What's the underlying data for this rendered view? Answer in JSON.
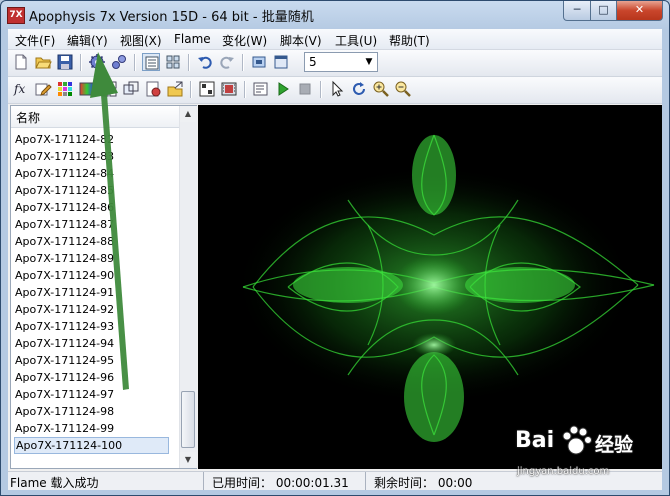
{
  "window": {
    "title": "Apophysis 7x Version 15D  - 64 bit - 批量随机",
    "app_icon": "7X",
    "controls": {
      "minimize": "─",
      "maximize": "□",
      "close": "✕"
    }
  },
  "menu": [
    {
      "label": "文件(F)"
    },
    {
      "label": "编辑(Y)"
    },
    {
      "label": "视图(X)"
    },
    {
      "label": "Flame"
    },
    {
      "label": "变化(W)"
    },
    {
      "label": "脚本(V)"
    },
    {
      "label": "工具(U)"
    },
    {
      "label": "帮助(T)"
    }
  ],
  "toolbar": {
    "zoom_select_value": "5",
    "zoom_select_arrow": "▼"
  },
  "list": {
    "header": "名称",
    "items": [
      "Apo7X-171124-82",
      "Apo7X-171124-83",
      "Apo7X-171124-84",
      "Apo7X-171124-85",
      "Apo7X-171124-86",
      "Apo7X-171124-87",
      "Apo7X-171124-88",
      "Apo7X-171124-89",
      "Apo7X-171124-90",
      "Apo7X-171124-91",
      "Apo7X-171124-92",
      "Apo7X-171124-93",
      "Apo7X-171124-94",
      "Apo7X-171124-95",
      "Apo7X-171124-96",
      "Apo7X-171124-97",
      "Apo7X-171124-98",
      "Apo7X-171124-99",
      "Apo7X-171124-100"
    ],
    "selected_index": 18,
    "scroll_up": "▲",
    "scroll_down": "▼"
  },
  "status": {
    "message": "Flame 载入成功",
    "elapsed": "已用时间：  00:00:01.31",
    "remaining": "剩余时间：  00:00"
  },
  "watermark": {
    "brand_a": "Bai",
    "brand_b": "经验",
    "url": "jingyan.baidu.com"
  },
  "colors": {
    "fractal_green": "#33dd33",
    "annotation_arrow": "#3f8a3c",
    "selection": "#dfeaf8"
  }
}
